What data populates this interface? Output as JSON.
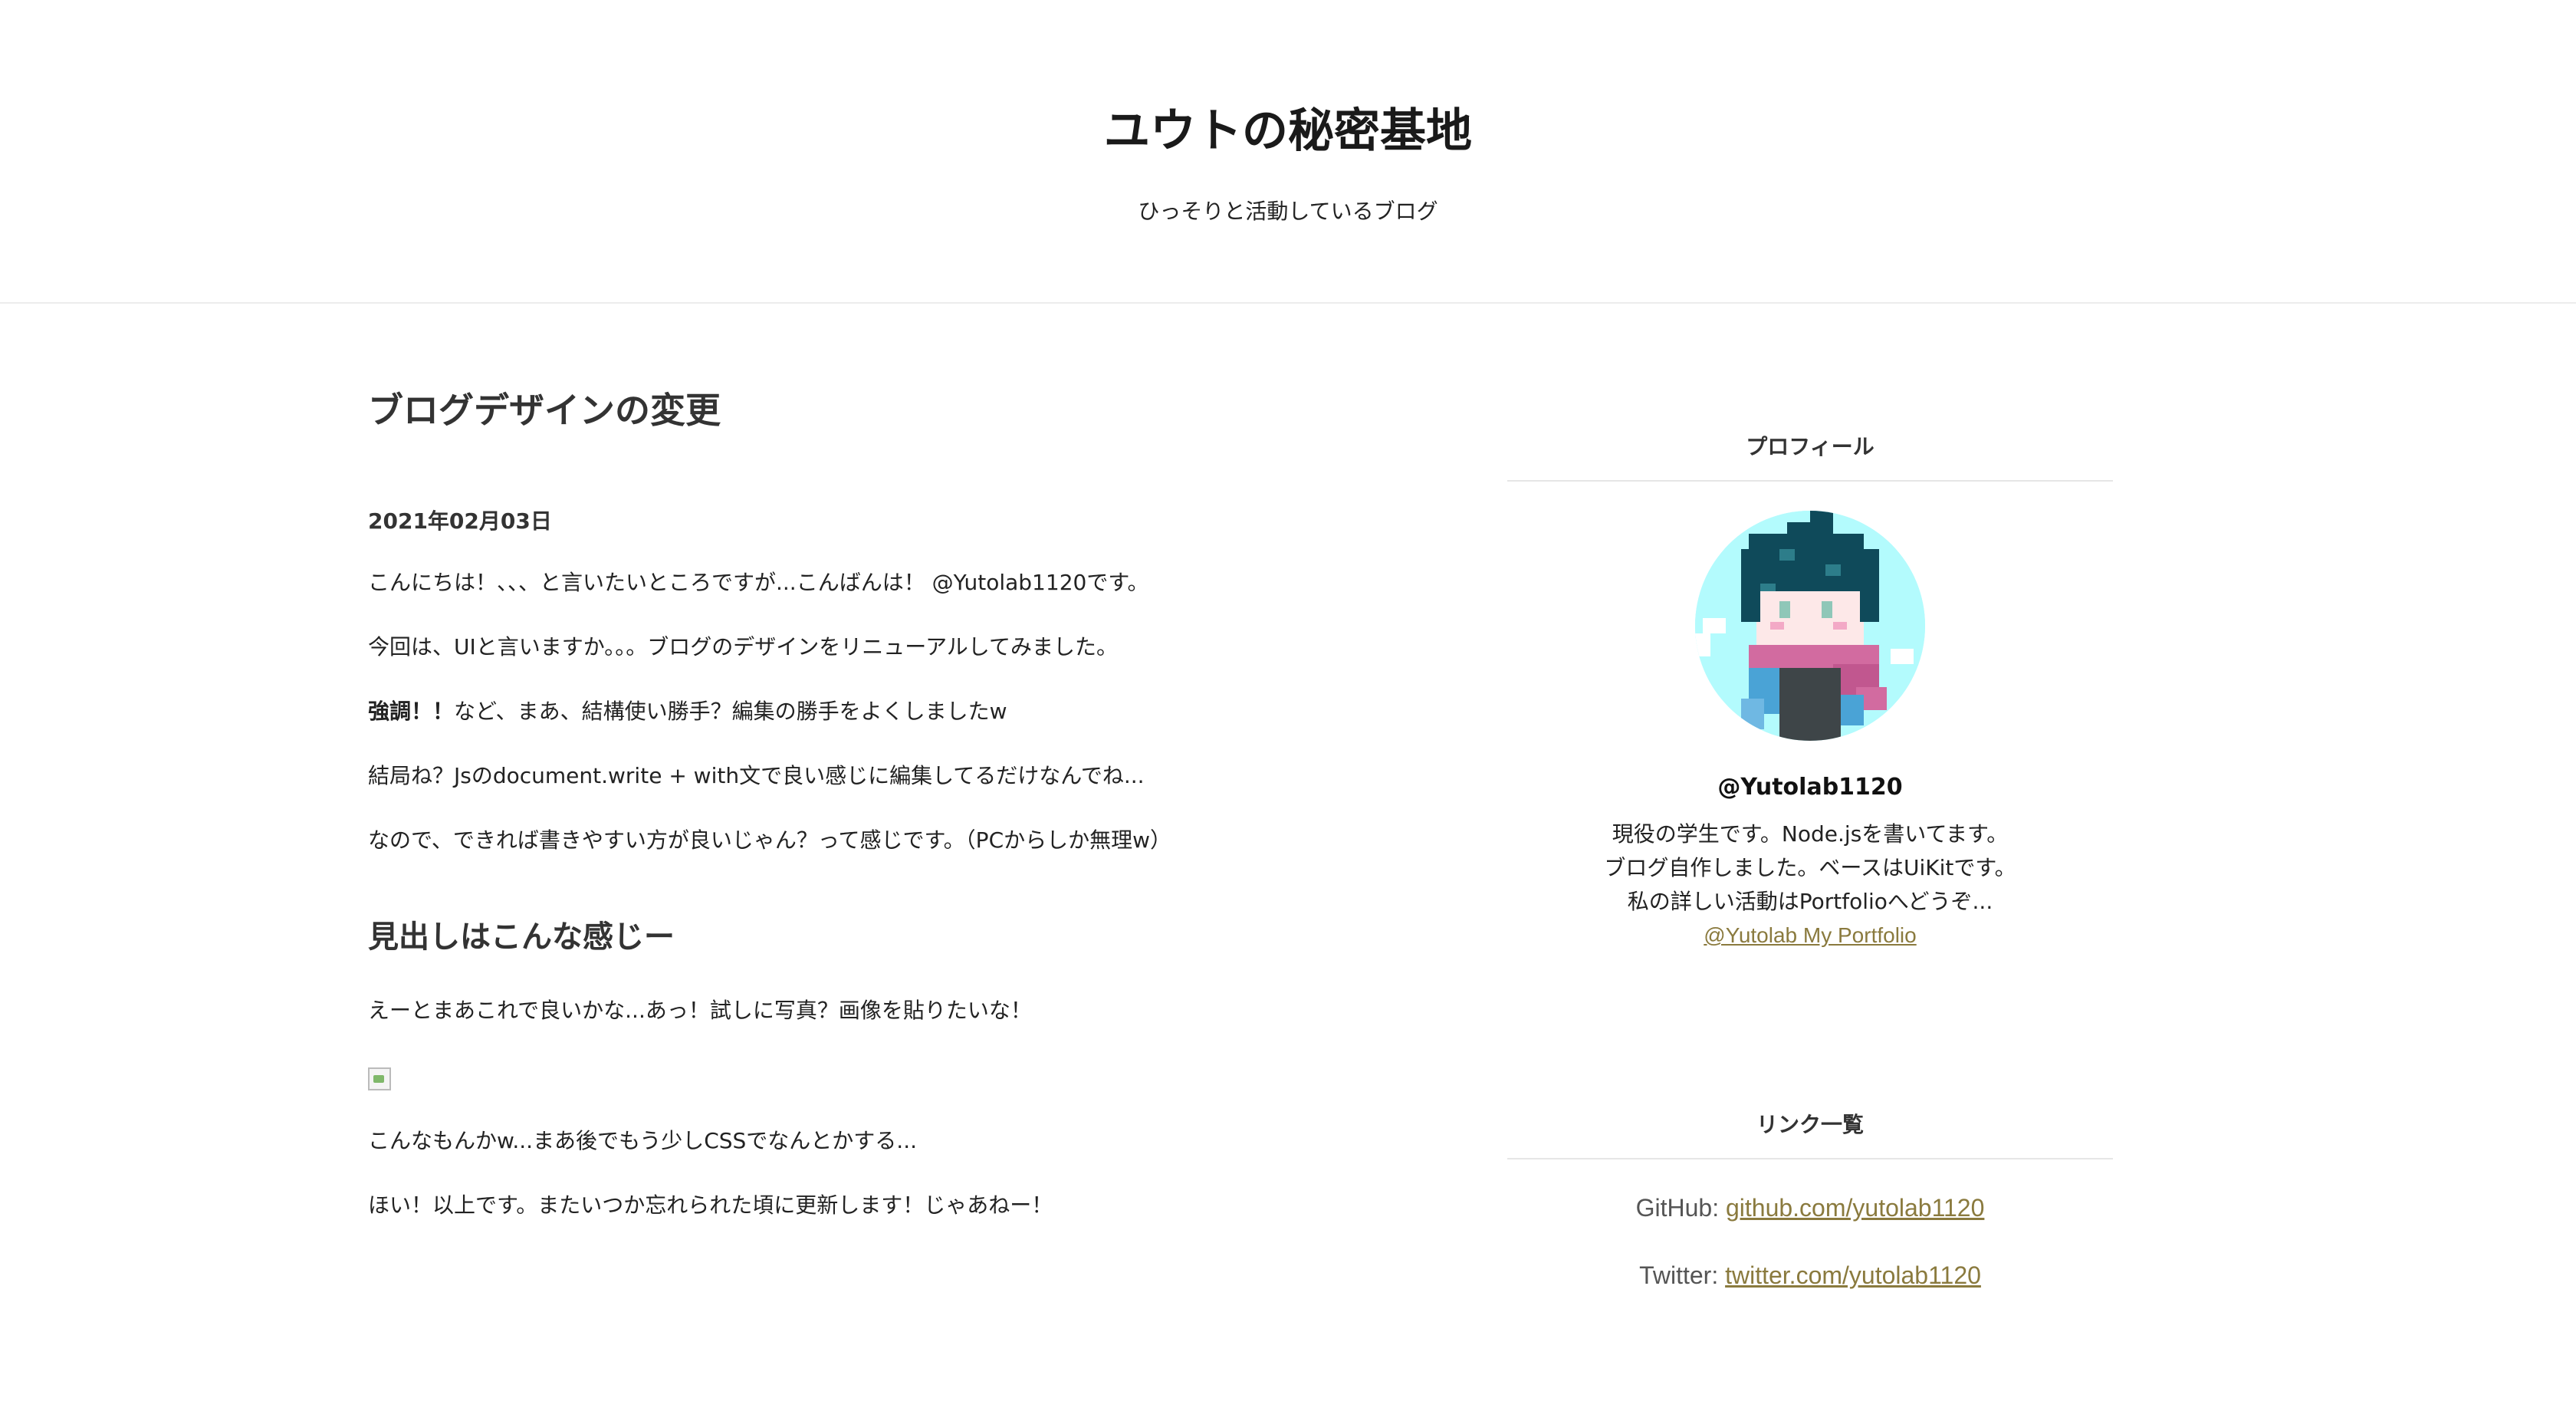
{
  "header": {
    "title": "ユウトの秘密基地",
    "subtitle": "ひっそりと活動しているブログ"
  },
  "article": {
    "title": "ブログデザインの変更",
    "date": "2021年02月03日",
    "p1": "こんにちは！、、、と言いたいところですが...こんばんは！ @Yutolab1120です。",
    "p2": "今回は、UIと言いますか。。。ブログのデザインをリニューアルしてみました。",
    "p3_bold": "強調！！",
    "p3_rest": "など、まあ、結構使い勝手？編集の勝手をよくしましたw",
    "p4": "結局ね？Jsのdocument.write + with文で良い感じに編集してるだけなんでね...",
    "p5": "なので、できれば書きやすい方が良いじゃん？って感じです。（PCからしか無理w）",
    "heading2": "見出しはこんな感じー",
    "p6": "えーとまあこれで良いかな...あっ！試しに写真？画像を貼りたいな！",
    "p7": "こんなもんかw...まあ後でもう少しCSSでなんとかする...",
    "p8": "ほい！以上です。またいつか忘れられた頃に更新します！じゃあねー！"
  },
  "sidebar": {
    "profile_title": "プロフィール",
    "profile_name": "@Yutolab1120",
    "profile_line1": "現役の学生です。Node.jsを書いてます。",
    "profile_line2": "ブログ自作しました。ベースはUiKitです。",
    "profile_line3": "私の詳しい活動はPortfolioへどうぞ...",
    "portfolio_link": "@Yutolab My Portfolio",
    "links_title": "リンク一覧",
    "github_label": "GitHub:",
    "github_link": "github.com/yutolab1120",
    "twitter_label": "Twitter:",
    "twitter_link": "twitter.com/yutolab1120"
  },
  "colors": {
    "link": "#8a7a3e",
    "avatar_bg": "#b3fbfd",
    "header_border": "#ececec"
  }
}
